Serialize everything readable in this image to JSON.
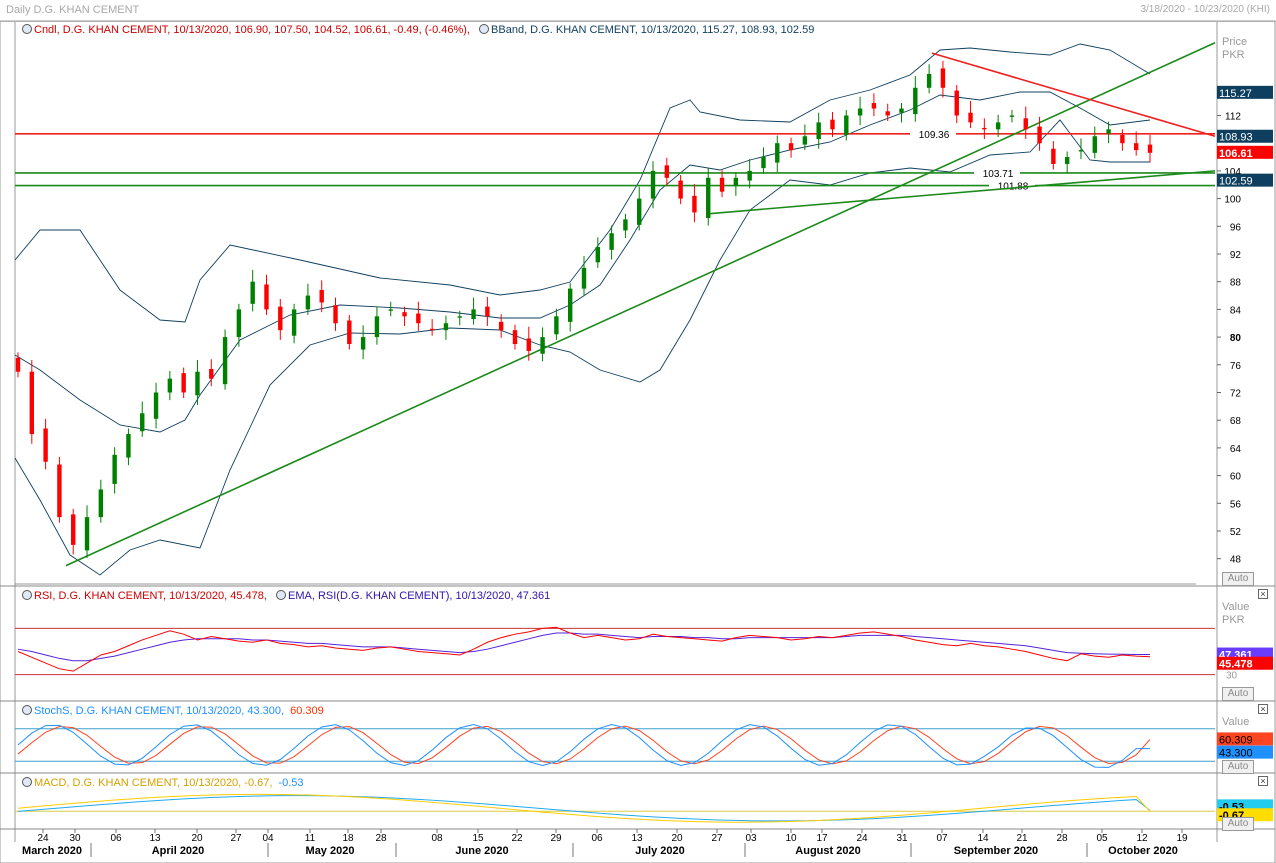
{
  "header": {
    "title": "Daily D.G. KHAN CEMENT",
    "date_range": "3/18/2020 - 10/23/2020 (KHI)"
  },
  "colors": {
    "up": "#008000",
    "down": "#ff0000",
    "band": "#0f3f5f",
    "trend_green": "#1a8a1a",
    "trend_red": "#ee2020",
    "rsi": "#ff0000",
    "rsi_ema": "#5522dd",
    "stoch_k": "#ff4422",
    "stoch_d": "#1e90ff",
    "macd": "#ffcc00",
    "macd_signal": "#22aaee"
  },
  "price_pane": {
    "axis_caption": [
      "Price",
      "PKR"
    ],
    "auto_label": "Auto",
    "legend": [
      {
        "text": "Cndl, D.G. KHAN CEMENT, 10/13/2020, 106.90, 107.50, 104.52, 106.61, -0.49, (-0.46%),",
        "color": "#cc0000"
      },
      {
        "text": "BBand, D.G. KHAN CEMENT, 10/13/2020, 115.27, 108.93, 102.59",
        "color": "#0f3f5f"
      }
    ],
    "badges": [
      {
        "text": "115.27",
        "value": 115.27,
        "bg": "#0f3f5f",
        "fg": "#ffffff"
      },
      {
        "text": "108.93",
        "value": 108.93,
        "bg": "#0f3f5f",
        "fg": "#ffffff"
      },
      {
        "text": "106.61",
        "value": 106.61,
        "bg": "#ff0000",
        "fg": "#ffffff"
      },
      {
        "text": "102.59",
        "value": 102.59,
        "bg": "#0f3f5f",
        "fg": "#ffffff"
      }
    ],
    "line_labels": [
      {
        "text": "109.36",
        "value": 109.36
      },
      {
        "text": "103.71",
        "value": 103.71
      },
      {
        "text": "101.88",
        "value": 101.88
      }
    ]
  },
  "rsi_pane": {
    "legend": [
      {
        "text": "RSI, D.G. KHAN CEMENT, 10/13/2020, 45.478,",
        "color": "#cc0000"
      },
      {
        "text": "EMA, RSI(D.G. KHAN CEMENT), 10/13/2020, 47.361",
        "color": "#3311aa"
      }
    ],
    "axis_caption": [
      "Value",
      "PKR"
    ],
    "level_label": "30",
    "badges": [
      {
        "text": "47.361",
        "bg": "#6a3cff",
        "fg": "#ffffff"
      },
      {
        "text": "45.478",
        "bg": "#ff0000",
        "fg": "#ffffff"
      }
    ],
    "auto_label": "Auto"
  },
  "stoch_pane": {
    "legend": [
      {
        "text": "StochS, D.G. KHAN CEMENT, 10/13/2020, 43.300,",
        "color": "#1e90ff"
      },
      {
        "text": "60.309",
        "color": "#ff3300"
      }
    ],
    "axis_caption": [
      "Value"
    ],
    "badges": [
      {
        "text": "60.309",
        "bg": "#ff4422",
        "fg": "#000000"
      },
      {
        "text": "43.300",
        "bg": "#1e90ff",
        "fg": "#000000"
      }
    ],
    "auto_label": "Auto"
  },
  "macd_pane": {
    "legend": [
      {
        "text": "MACD, D.G. KHAN CEMENT, 10/13/2020, -0.67,",
        "color": "#d4a000"
      },
      {
        "text": "-0.53",
        "color": "#1e90ff"
      }
    ],
    "badges": [
      {
        "text": "-0.53",
        "bg": "#22ccee",
        "fg": "#000000"
      },
      {
        "text": "-0.67",
        "bg": "#ffdd00",
        "fg": "#000000"
      }
    ],
    "auto_label": "Auto"
  },
  "x_axis": {
    "day_labels": [
      "24",
      "30",
      "06",
      "13",
      "20",
      "27",
      "04",
      "11",
      "18",
      "28",
      "08",
      "15",
      "22",
      "29",
      "06",
      "13",
      "20",
      "27",
      "03",
      "10",
      "17",
      "24",
      "31",
      "07",
      "14",
      "21",
      "28",
      "05",
      "12",
      "19"
    ],
    "month_labels": [
      "March 2020",
      "April 2020",
      "May 2020",
      "June 2020",
      "July 2020",
      "August 2020",
      "September 2020",
      "October 2020"
    ]
  },
  "chart_data": [
    {
      "type": "candlestick",
      "title": "Daily D.G. KHAN CEMENT",
      "ylabel": "Price PKR",
      "ylim": [
        44.2,
        125.5
      ],
      "yticks": [
        48,
        52,
        56,
        60,
        64,
        68,
        72,
        76,
        80,
        84,
        88,
        92,
        96,
        100,
        104,
        112
      ],
      "major_ytick": 80,
      "close_path": [
        75,
        66,
        62,
        54,
        50,
        54,
        58,
        63,
        66,
        69,
        72,
        74,
        72,
        75,
        74,
        80,
        84,
        88,
        84,
        81,
        84,
        86,
        85,
        82,
        79,
        80,
        83,
        84,
        83,
        82,
        81,
        82,
        83,
        84,
        83,
        81,
        79,
        78,
        80,
        83,
        87,
        90,
        93,
        95,
        97,
        100,
        104,
        103,
        100,
        98,
        103,
        101,
        103,
        104,
        106,
        108,
        107,
        109,
        111,
        110,
        112,
        113,
        113,
        112,
        113,
        116,
        118,
        116,
        112,
        111,
        110,
        111,
        112,
        110,
        108,
        105,
        106,
        107,
        109,
        110,
        108,
        107,
        106.61
      ],
      "series": [
        {
          "name": "BBand",
          "values": [
            115.27,
            108.93,
            102.59
          ]
        }
      ],
      "horizontal_levels": [
        {
          "value": 109.36,
          "color": "red"
        },
        {
          "value": 103.71,
          "color": "green"
        },
        {
          "value": 101.88,
          "color": "green"
        }
      ],
      "trendlines": [
        {
          "color": "green",
          "from": "30 Mar 2020, 47",
          "to": "late Oct 2020, 122.5"
        },
        {
          "color": "green",
          "from": "end Jul 2020, 97.8",
          "to": "mid Oct 2020, 104"
        },
        {
          "color": "red",
          "from": "early Sep 2020, 121",
          "to": "mid Oct 2020, 109"
        }
      ]
    },
    {
      "type": "line",
      "title": "RSI",
      "series": [
        {
          "name": "RSI",
          "last": 45.478
        },
        {
          "name": "EMA, RSI",
          "last": 47.361
        }
      ],
      "levels": [
        70,
        30
      ]
    },
    {
      "type": "line",
      "title": "StochS",
      "series": [
        {
          "name": "StochS %K",
          "last": 43.3
        },
        {
          "name": "StochS %D",
          "last": 60.309
        }
      ],
      "levels": [
        80,
        20
      ]
    },
    {
      "type": "line",
      "title": "MACD",
      "series": [
        {
          "name": "MACD",
          "last": -0.67
        },
        {
          "name": "Signal",
          "last": -0.53
        }
      ]
    }
  ]
}
